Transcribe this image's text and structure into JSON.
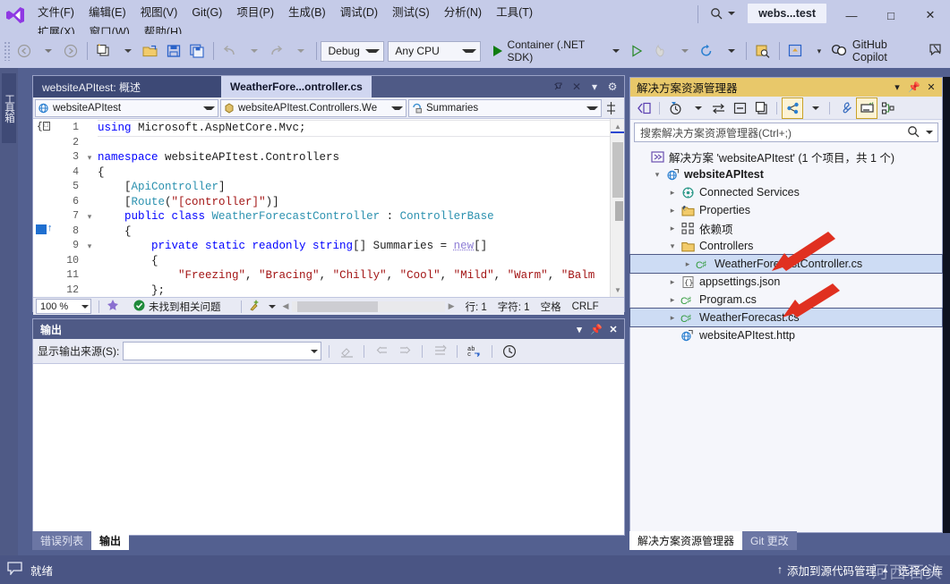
{
  "window": {
    "title": "webs...test",
    "minimize": "—",
    "maximize": "□",
    "close": "✕"
  },
  "menu": {
    "items": [
      {
        "label": "文件(F)",
        "mnemonic": "F"
      },
      {
        "label": "编辑(E)",
        "mnemonic": "E"
      },
      {
        "label": "视图(V)",
        "mnemonic": "V"
      },
      {
        "label": "Git(G)",
        "mnemonic": "G"
      },
      {
        "label": "项目(P)",
        "mnemonic": "P"
      },
      {
        "label": "生成(B)",
        "mnemonic": "B"
      },
      {
        "label": "调试(D)",
        "mnemonic": "D"
      },
      {
        "label": "测试(S)",
        "mnemonic": "S"
      },
      {
        "label": "分析(N)",
        "mnemonic": "N"
      },
      {
        "label": "工具(T)",
        "mnemonic": "T"
      },
      {
        "label": "扩展(X)",
        "mnemonic": "X"
      },
      {
        "label": "窗口(W)",
        "mnemonic": "W"
      },
      {
        "label": "帮助(H)",
        "mnemonic": "H"
      }
    ]
  },
  "toolbar": {
    "configuration": "Debug",
    "platform": "Any CPU",
    "run_target": "Container (.NET SDK)",
    "copilot_label": "GitHub Copilot",
    "icons": {
      "back": "back-navigate-icon",
      "forward": "forward-navigate-icon",
      "new_project": "new-project-icon",
      "open_file": "open-file-icon",
      "save": "save-icon",
      "save_all": "save-all-icon",
      "undo": "undo-icon",
      "redo": "redo-icon",
      "start": "start-debug-icon",
      "start_no_debug": "start-without-debugging-icon",
      "hot_reload": "hot-reload-icon",
      "restart": "restart-icon",
      "find_in_files": "find-in-files-icon",
      "window_layout": "window-layout-icon",
      "copilot": "copilot-icon",
      "feedback": "feedback-icon"
    }
  },
  "toolbox_tab": "工具箱",
  "editor": {
    "tabs": [
      {
        "label": "websiteAPItest: 概述",
        "active": false
      },
      {
        "label": "WeatherFore...ontroller.cs",
        "active": true
      }
    ],
    "tab_actions": {
      "pin": "pin-icon",
      "close": "close-icon",
      "dropdown": "tab-dropdown-icon",
      "settings": "gear-icon"
    },
    "nav_project": "websiteAPItest",
    "nav_type": "websiteAPItest.Controllers.We",
    "nav_member": "Summaries",
    "code_lines": [
      {
        "num": 1,
        "fold": "",
        "text_html": "<span class=\"kw\">using</span> Microsoft.AspNetCore.Mvc;"
      },
      {
        "num": 2,
        "fold": "",
        "text_html": ""
      },
      {
        "num": 3,
        "fold": "v",
        "text_html": "<span class=\"kw\">namespace</span> websiteAPItest.Controllers"
      },
      {
        "num": 4,
        "fold": "",
        "text_html": "{"
      },
      {
        "num": 5,
        "fold": "",
        "text_html": "    [<span class=\"type\">ApiController</span>]"
      },
      {
        "num": 6,
        "fold": "",
        "text_html": "    [<span class=\"type\">Route</span>(<span class=\"str\">\"[controller]\"</span>)]"
      },
      {
        "num": 7,
        "fold": "v",
        "text_html": "    <span class=\"kw\">public class</span> <span class=\"type\">WeatherForecastController</span> : <span class=\"type\">ControllerBase</span>"
      },
      {
        "num": 8,
        "fold": "",
        "text_html": "    {"
      },
      {
        "num": 9,
        "fold": "v",
        "text_html": "        <span class=\"kw\">private static readonly string</span>[] Summaries = <span class=\"newkw\">new</span>[]"
      },
      {
        "num": 10,
        "fold": "",
        "text_html": "        {"
      },
      {
        "num": 11,
        "fold": "",
        "text_html": "            <span class=\"str\">\"Freezing\"</span>, <span class=\"str\">\"Bracing\"</span>, <span class=\"str\">\"Chilly\"</span>, <span class=\"str\">\"Cool\"</span>, <span class=\"str\">\"Mild\"</span>, <span class=\"str\">\"Warm\"</span>, <span class=\"str\">\"Balm</span>"
      },
      {
        "num": 12,
        "fold": "",
        "text_html": "        };"
      }
    ],
    "status": {
      "zoom": "100 %",
      "issues": "未找到相关问题",
      "line_label": "行: 1",
      "char_label": "字符: 1",
      "spaces": "空格",
      "eol": "CRLF"
    }
  },
  "output_pane": {
    "title": "输出",
    "source_label": "显示输出来源(S):",
    "source_value": "",
    "actions": {
      "dropdown": "pane-dropdown-icon",
      "pin": "pin-icon",
      "close": "close-icon"
    },
    "toolbar_icons": [
      "clear-all-icon",
      "go-to-previous-icon",
      "go-to-next-icon",
      "toggle-word-wrap-icon",
      "find-icon",
      "history-icon"
    ]
  },
  "bottom_tabs": [
    {
      "label": "错误列表",
      "selected": false
    },
    {
      "label": "输出",
      "selected": true
    }
  ],
  "solution_explorer": {
    "title": "解决方案资源管理器",
    "actions": {
      "dropdown": "pane-dropdown-icon",
      "pin": "pin-icon",
      "close": "close-icon"
    },
    "toolbar_icons": [
      "code-view-icon",
      "pending-changes-filter-icon",
      "sync-with-active-document-icon",
      "collapse-all-icon",
      "refresh-icon",
      "show-all-files-icon",
      "properties-wrench-icon",
      "preview-selected-items-icon",
      "solution-view-icon"
    ],
    "search_placeholder": "搜索解决方案资源管理器(Ctrl+;)",
    "tree": [
      {
        "indent": 0,
        "expander": "",
        "icon": "solution-icon",
        "label": "解决方案 'websiteAPItest' (1 个项目，共 1 个)",
        "bold": false,
        "selected": false
      },
      {
        "indent": 1,
        "expander": "down",
        "icon": "web-project-icon",
        "label": "websiteAPItest",
        "bold": true,
        "selected": false
      },
      {
        "indent": 2,
        "expander": "right",
        "icon": "connected-services-icon",
        "label": "Connected Services",
        "bold": false,
        "selected": false
      },
      {
        "indent": 2,
        "expander": "right",
        "icon": "properties-icon",
        "label": "Properties",
        "bold": false,
        "selected": false
      },
      {
        "indent": 2,
        "expander": "right",
        "icon": "dependencies-icon",
        "label": "依赖项",
        "bold": false,
        "selected": false
      },
      {
        "indent": 2,
        "expander": "down",
        "icon": "folder-icon",
        "label": "Controllers",
        "bold": false,
        "selected": false
      },
      {
        "indent": 3,
        "expander": "right",
        "icon": "csharp-file-icon",
        "label": "WeatherForecastController.cs",
        "bold": false,
        "selected": true
      },
      {
        "indent": 2,
        "expander": "right",
        "icon": "json-file-icon",
        "label": "appsettings.json",
        "bold": false,
        "selected": false
      },
      {
        "indent": 2,
        "expander": "right",
        "icon": "csharp-file-icon",
        "label": "Program.cs",
        "bold": false,
        "selected": false
      },
      {
        "indent": 2,
        "expander": "right",
        "icon": "csharp-file-icon",
        "label": "WeatherForecast.cs",
        "bold": false,
        "selected": true
      },
      {
        "indent": 2,
        "expander": "",
        "icon": "http-file-icon",
        "label": "websiteAPItest.http",
        "bold": false,
        "selected": false
      }
    ],
    "bottom_tabs": [
      {
        "label": "解决方案资源管理器",
        "selected": true
      },
      {
        "label": "Git 更改",
        "selected": false
      }
    ]
  },
  "statusbar": {
    "ready": "就绪",
    "ready_icon": "message-icon",
    "add_to_source_control": "添加到源代码管理",
    "add_arrow": "↑",
    "add_caret": "▲",
    "select_repo": "选择仓库",
    "watermark": "河西石头"
  },
  "colors": {
    "chrome": "#c5cbe8",
    "panel_header_accent": "#e8c86a",
    "tab_active": "#d0d6f0",
    "statusbar": "#4a5584",
    "selection": "#cddcf4",
    "annotation_arrow": "#e03020"
  }
}
